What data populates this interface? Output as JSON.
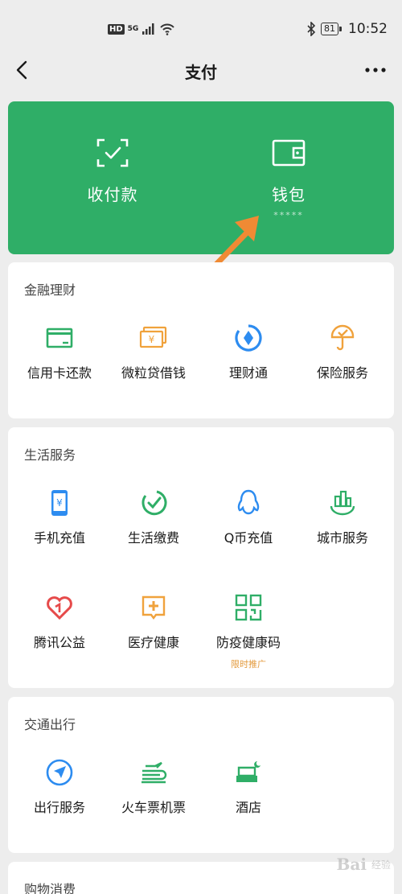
{
  "status_bar": {
    "hd": "HD",
    "network": "5G",
    "battery": "81",
    "time": "10:52"
  },
  "nav": {
    "title": "支付",
    "back_icon": "chevron-left-icon",
    "more_icon": "more-horizontal-icon"
  },
  "wallet_card": {
    "color": "#2fae67",
    "collect_pay": {
      "label": "收付款",
      "icon": "scan-check-icon"
    },
    "wallet": {
      "label": "钱包",
      "masked_balance": "*****",
      "icon": "wallet-icon"
    },
    "annotation_arrow_color": "#f08a34"
  },
  "sections": [
    {
      "title": "金融理财",
      "items": [
        {
          "label": "信用卡还款",
          "icon": "credit-card-icon",
          "color": "#2fae67"
        },
        {
          "label": "微粒贷借钱",
          "icon": "yen-bill-icon",
          "color": "#f0a23c"
        },
        {
          "label": "理财通",
          "icon": "wealth-icon",
          "color": "#2d8cf0"
        },
        {
          "label": "保险服务",
          "icon": "umbrella-icon",
          "color": "#f0a23c"
        }
      ]
    },
    {
      "title": "生活服务",
      "items": [
        {
          "label": "手机充值",
          "icon": "phone-yen-icon",
          "color": "#2d8cf0"
        },
        {
          "label": "生活缴费",
          "icon": "check-circle-icon",
          "color": "#2fae67"
        },
        {
          "label": "Q币充值",
          "icon": "penguin-icon",
          "color": "#2d8cf0"
        },
        {
          "label": "城市服务",
          "icon": "city-icon",
          "color": "#2fae67"
        },
        {
          "label": "腾讯公益",
          "icon": "heart-icon",
          "color": "#e64a4a"
        },
        {
          "label": "医疗健康",
          "icon": "medical-plus-icon",
          "color": "#f0a23c"
        },
        {
          "label": "防疫健康码",
          "icon": "qr-code-icon",
          "color": "#2fae67",
          "badge": "限时推广"
        }
      ]
    },
    {
      "title": "交通出行",
      "items": [
        {
          "label": "出行服务",
          "icon": "navigation-icon",
          "color": "#2d8cf0"
        },
        {
          "label": "火车票机票",
          "icon": "train-plane-icon",
          "color": "#2fae67"
        },
        {
          "label": "酒店",
          "icon": "bed-icon",
          "color": "#2fae67"
        }
      ]
    },
    {
      "title": "购物消费",
      "items": []
    }
  ],
  "watermark": {
    "text": "Bai",
    "sub": "经验"
  }
}
